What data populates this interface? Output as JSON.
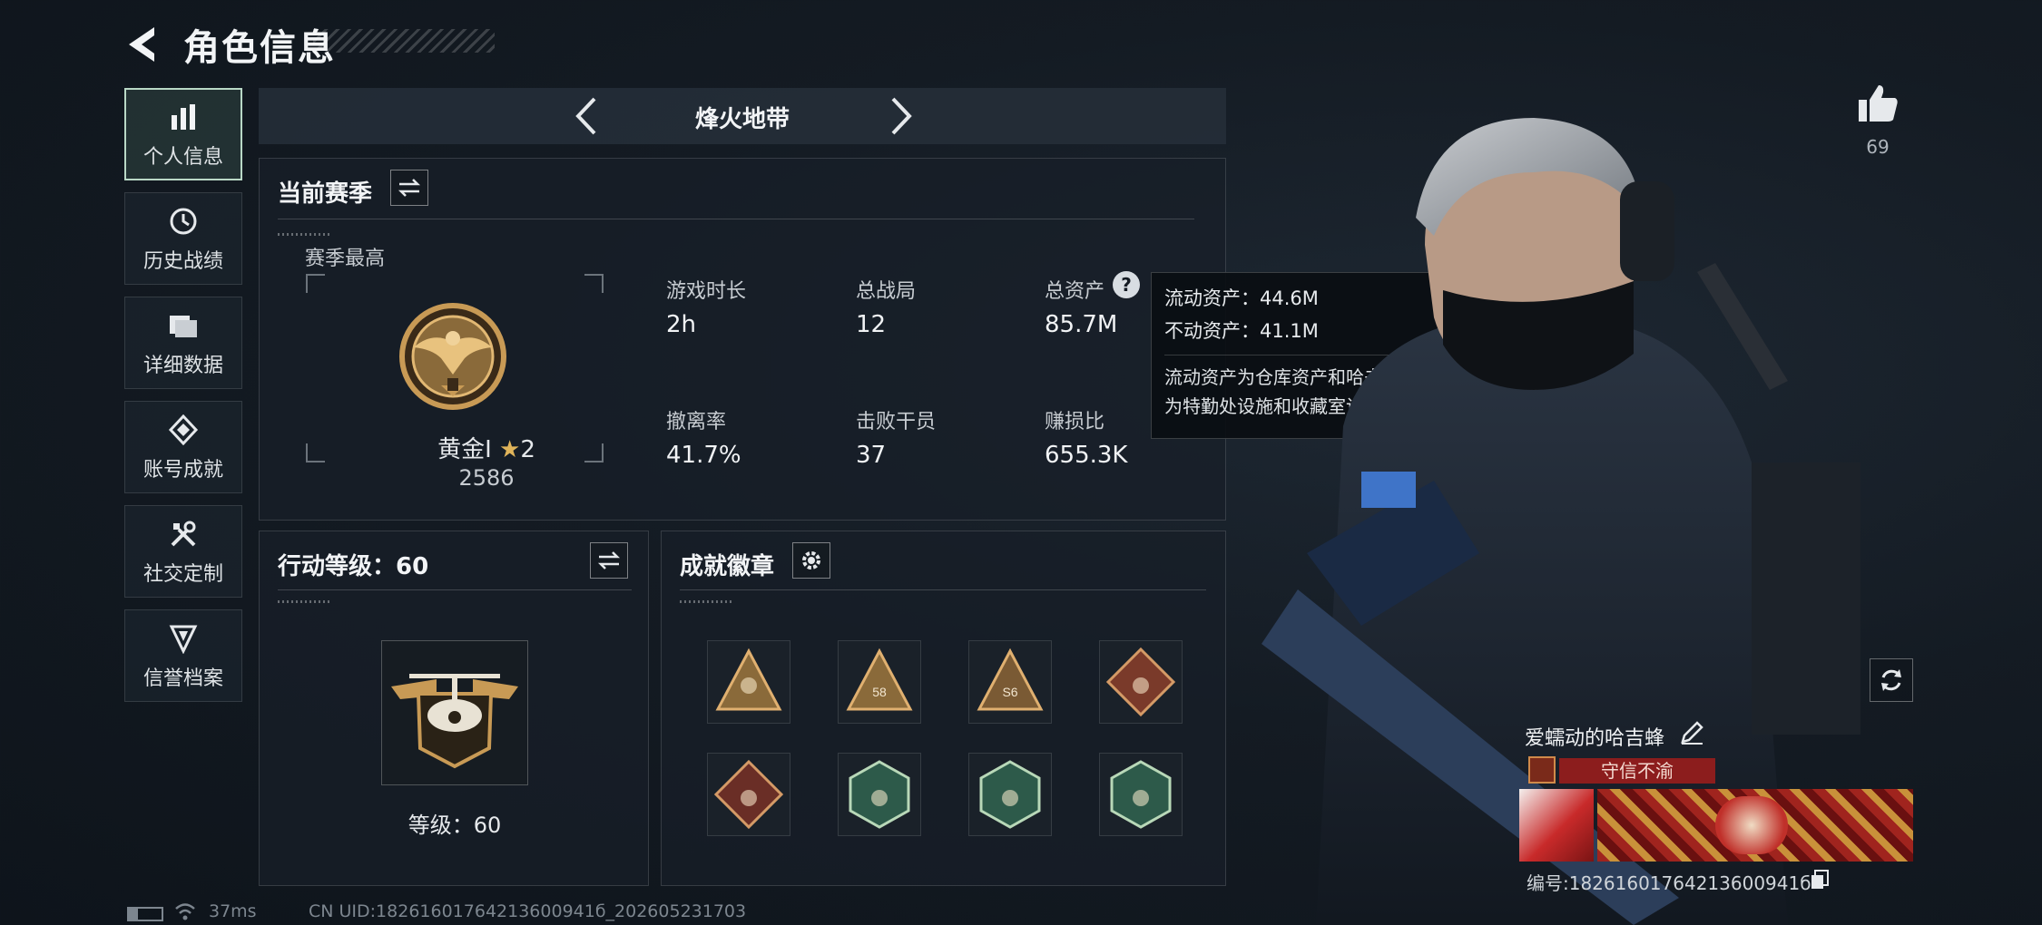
{
  "header": {
    "title": "角色信息"
  },
  "sidebar": {
    "items": [
      {
        "label": "个人信息",
        "icon": "bar-chart-icon",
        "active": true
      },
      {
        "label": "历史战绩",
        "icon": "history-icon"
      },
      {
        "label": "详细数据",
        "icon": "folder-icon"
      },
      {
        "label": "账号成就",
        "icon": "achievement-icon"
      },
      {
        "label": "社交定制",
        "icon": "tools-icon"
      },
      {
        "label": "信誉档案",
        "icon": "credit-shield-icon"
      }
    ]
  },
  "mode": {
    "title": "烽火地带"
  },
  "season": {
    "title": "当前赛季",
    "best_label": "赛季最高",
    "rank_name": "黄金Ⅰ",
    "stars": "2",
    "rank_score": "2586",
    "stats": [
      {
        "label": "游戏时长",
        "value": "2h"
      },
      {
        "label": "总战局",
        "value": "12"
      },
      {
        "label": "总资产",
        "value": "85.7M"
      },
      {
        "label": "撤离率",
        "value": "41.7%"
      },
      {
        "label": "击败干员",
        "value": "37"
      },
      {
        "label": "赚损比",
        "value": "655.3K"
      }
    ]
  },
  "tooltip": {
    "liquid": "流动资产：44.6M",
    "fixed": "不动资产：41.1M",
    "desc_line1": "流动资产为仓库资产和哈夫币，不动资产",
    "desc_line2": "为特勤处设施和收藏室设施"
  },
  "level_panel": {
    "title": "行动等级：60",
    "level_text": "等级：60"
  },
  "badges_panel": {
    "title": "成就徽章",
    "badges": [
      {
        "name": "badge-bronze-triangle-1",
        "shape": "triangle",
        "color": "#8a6a3a"
      },
      {
        "name": "badge-bronze-triangle-58",
        "shape": "triangle",
        "color": "#8a6a3a",
        "text": "58"
      },
      {
        "name": "badge-bronze-triangle-s6",
        "shape": "triangle",
        "color": "#7a5a34",
        "text": "S6"
      },
      {
        "name": "badge-red-diamond-wolf",
        "shape": "diamond",
        "color": "#7a3a2a"
      },
      {
        "name": "badge-red-diamond-dragon",
        "shape": "diamond",
        "color": "#6a2e26"
      },
      {
        "name": "badge-green-hex-1",
        "shape": "hex",
        "color": "#2d5a4a"
      },
      {
        "name": "badge-green-hex-2",
        "shape": "hex",
        "color": "#2d5a4a"
      },
      {
        "name": "badge-green-hex-3",
        "shape": "hex",
        "color": "#2d5a4a"
      }
    ]
  },
  "likes": {
    "count": "69"
  },
  "profile": {
    "nickname": "爱蠕动的哈吉蜂",
    "title_badge": "守信不渝",
    "id_text": "编号:18261601764213600941б"
  },
  "status_bar": {
    "ping": "37ms",
    "uid": "CN UID:18261601764213600941б_202605231703"
  },
  "colors": {
    "accent_red": "#8c1d1d",
    "accent_green": "#b9d8c6",
    "gold": "#c89a55"
  }
}
